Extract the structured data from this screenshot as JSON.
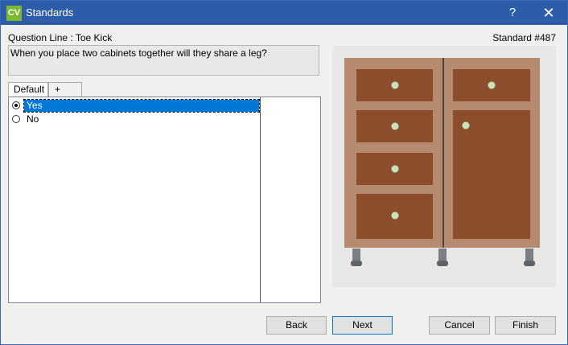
{
  "window": {
    "title": "Standards",
    "app_icon": "CV",
    "help": "?",
    "close": "✕"
  },
  "question": {
    "line_label": "Question Line : Toe Kick",
    "standard": "Standard #487",
    "text": "When you place two cabinets together will they share a leg?"
  },
  "tabs": [
    {
      "label": "Default",
      "active": true
    },
    {
      "label": "+",
      "active": false
    }
  ],
  "options": [
    {
      "label": "Yes",
      "checked": true
    },
    {
      "label": "No",
      "checked": false
    }
  ],
  "preview": {
    "icon": "cabinet-illustration",
    "colors": {
      "frame": "#b58a6e",
      "panel": "#8b4d2b",
      "knob": "#c8e2b9"
    }
  },
  "buttons": {
    "back": "Back",
    "next": "Next",
    "cancel": "Cancel",
    "finish": "Finish"
  }
}
